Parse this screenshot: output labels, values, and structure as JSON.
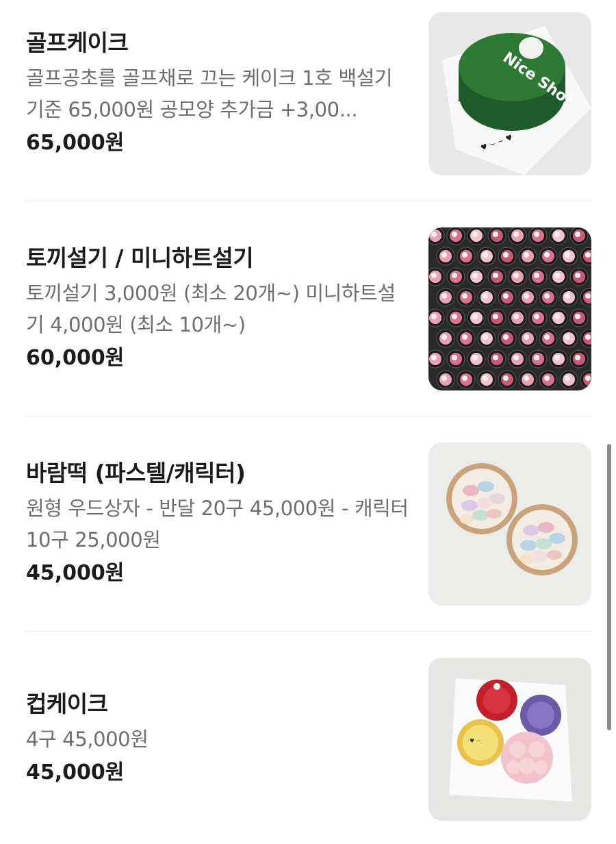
{
  "items": [
    {
      "name": "골프케이크",
      "description": "골프공초를 골프채로 끄는 케이크 1호 백설기기준 65,000원 공모양 추가금 +3,00...",
      "price": "65,000원",
      "image_icon": "golf-cake-photo",
      "image_text": "Nice Shot"
    },
    {
      "name": "토끼설기 / 미니하트설기",
      "description": "토끼설기 3,000원 (최소 20개~) 미니하트설기 4,000원 (최소 10개~)",
      "price": "60,000원",
      "image_icon": "rabbit-rice-cake-photo"
    },
    {
      "name": "바람떡 (파스텔/캐릭터)",
      "description": "원형 우드상자 - 반달 20구 45,000원 - 캐릭터 10구 25,000원",
      "price": "45,000원",
      "image_icon": "pastel-rice-cake-box-photo"
    },
    {
      "name": "컵케이크",
      "description": "4구 45,000원",
      "price": "45,000원",
      "image_icon": "cupcake-box-photo"
    }
  ],
  "colors": {
    "name": "#1b1b1b",
    "description": "#6e6e6e",
    "divider": "#ececec",
    "scrollbar": "#8a8a8a"
  }
}
